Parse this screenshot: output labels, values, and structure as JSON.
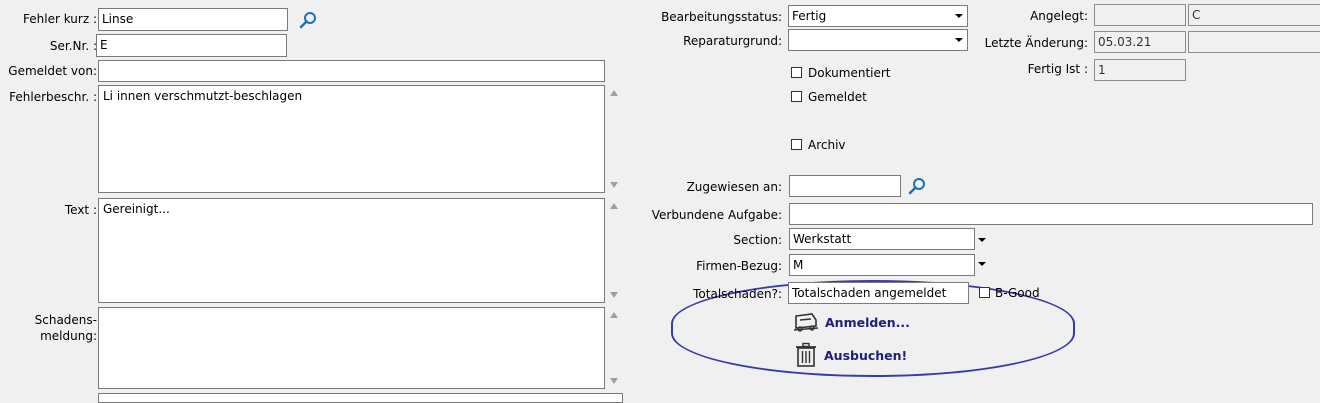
{
  "left": {
    "fehler_kurz_label": "Fehler kurz :",
    "fehler_kurz_value": "Linse",
    "sernr_label": "Ser.Nr. :",
    "sernr_value": "E",
    "gemeldet_von_label": "Gemeldet von:",
    "gemeldet_von_value": "",
    "fehlerbeschr_label": "Fehlerbeschr. :",
    "fehlerbeschr_value": "Li           innen verschmutzt-beschlagen",
    "text_label": "Text :",
    "text_value": "Gereinigt...",
    "schadensmeldung_label_1": "Schadens-",
    "schadensmeldung_label_2": "meldung:",
    "schadensmeldung_value": ""
  },
  "right": {
    "bearbeitungsstatus_label": "Bearbeitungsstatus:",
    "bearbeitungsstatus_value": "Fertig",
    "reparaturgrund_label": "Reparaturgrund:",
    "reparaturgrund_value": "",
    "dokumentiert_label": "Dokumentiert",
    "gemeldet_label": "Gemeldet",
    "archiv_label": "Archiv",
    "angelegt_label": "Angelegt:",
    "angelegt_value_1": "",
    "angelegt_value_2": "C",
    "letzte_aenderung_label": "Letzte Änderung:",
    "letzte_aenderung_value_1": "05.03.21",
    "letzte_aenderung_value_2": "",
    "fertig_ist_label": "Fertig Ist :",
    "fertig_ist_value": "1",
    "zugewiesen_label": "Zugewiesen an:",
    "zugewiesen_value": "",
    "verbundene_label": "Verbundene Aufgabe:",
    "verbundene_value": "",
    "section_label": "Section:",
    "section_value": "Werkstatt",
    "firmen_label": "Firmen-Bezug:",
    "firmen_value": "M",
    "totalschaden_label": "Totalschaden?:",
    "totalschaden_value": "Totalschaden angemeldet",
    "bgood_label": "B-Good",
    "anmelden_label": "Anmelden...",
    "ausbuchen_label": "Ausbuchen!"
  }
}
